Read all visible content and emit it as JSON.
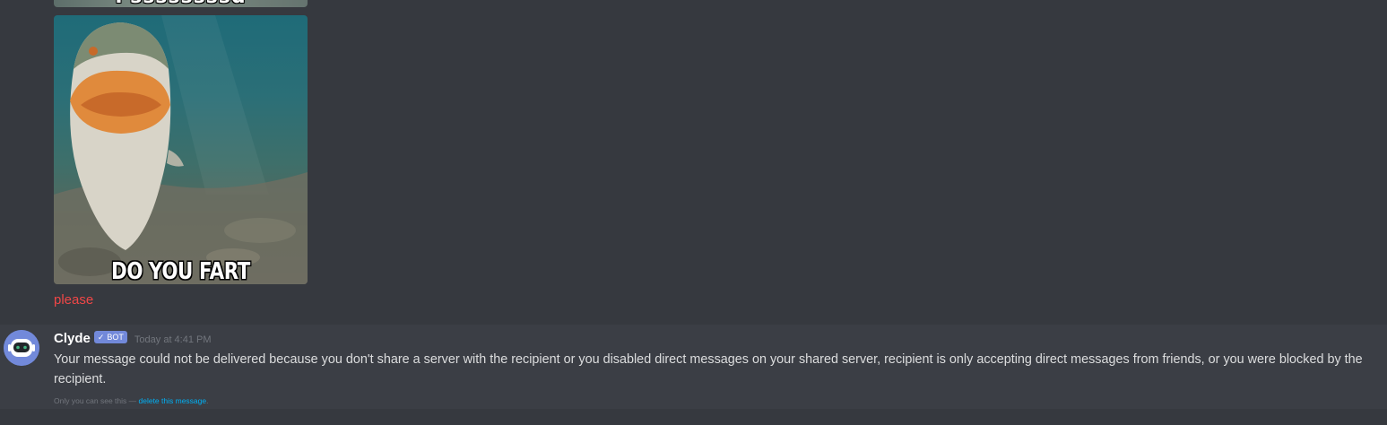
{
  "previous_image": {
    "caption": "Pssssssssd"
  },
  "meme": {
    "caption": "DO YOU FART"
  },
  "red_message": {
    "text": "please",
    "color": "#f04747"
  },
  "clyde_message": {
    "author": "Clyde",
    "bot_tag": "BOT",
    "bot_check_icon": "check-icon",
    "timestamp": "Today at 4:41 PM",
    "body": "Your message could not be delivered because you don't share a server with the recipient or you disabled direct messages on your shared server, recipient is only accepting direct messages from friends, or you were blocked by the recipient.",
    "ephemeral_notice": "Only you can see this — ",
    "ephemeral_link": "delete this message",
    "ephemeral_end": "."
  },
  "colors": {
    "background": "#36393f",
    "highlight_row": "#3b3e45",
    "blurple": "#7289da",
    "link": "#00b0f4"
  }
}
